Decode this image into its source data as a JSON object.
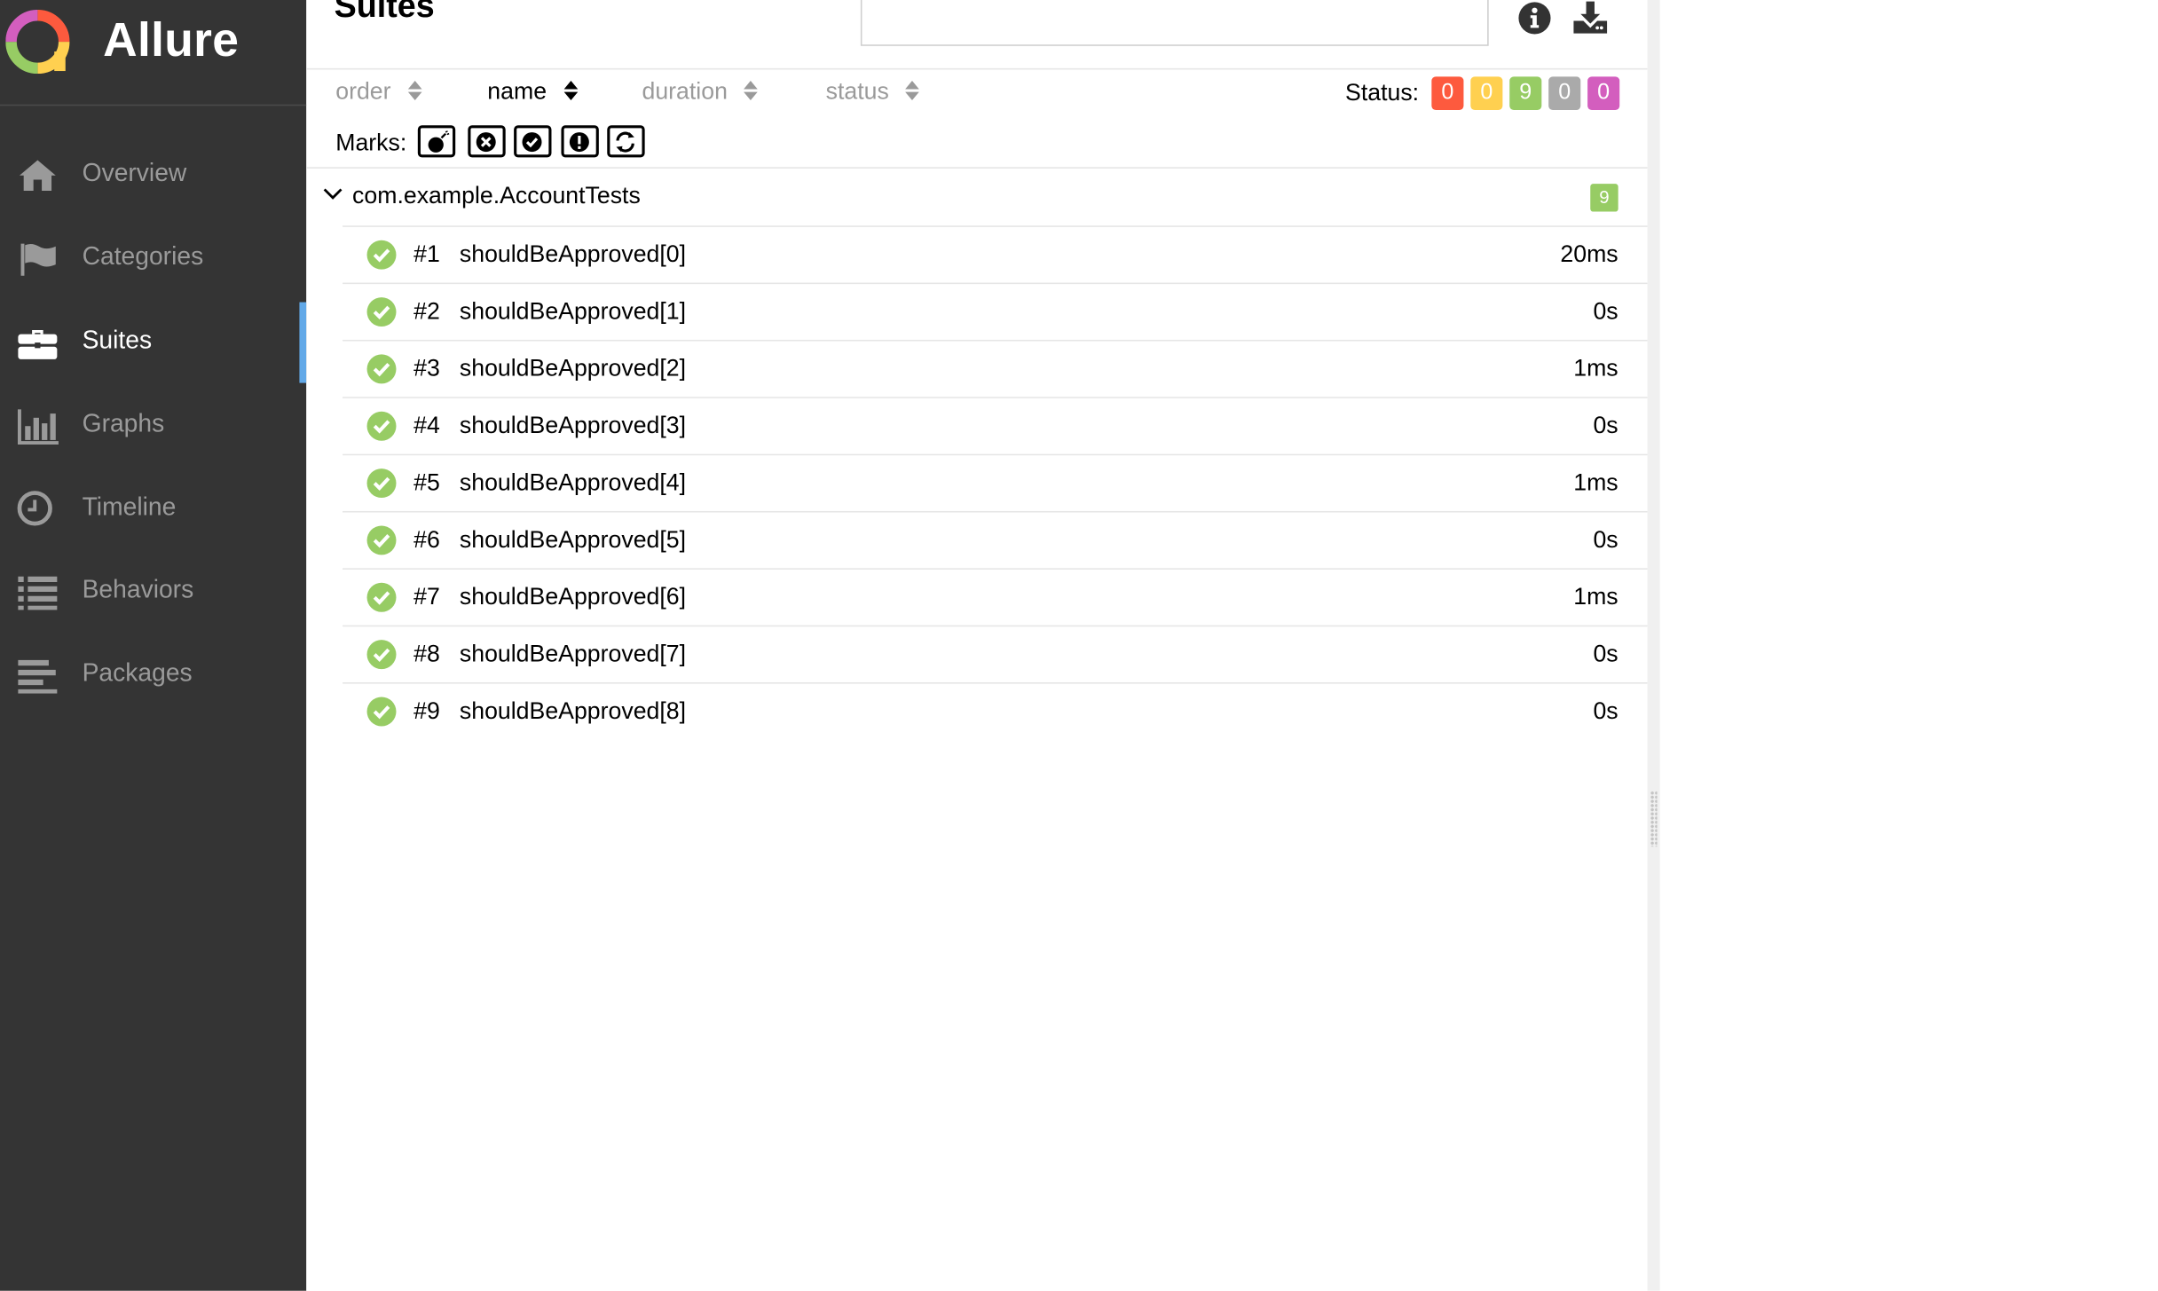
{
  "app": {
    "name": "Allure"
  },
  "sidebar": {
    "items": [
      {
        "label": "Overview",
        "icon": "home-icon",
        "active": false
      },
      {
        "label": "Categories",
        "icon": "flag-icon",
        "active": false
      },
      {
        "label": "Suites",
        "icon": "briefcase-icon",
        "active": true
      },
      {
        "label": "Graphs",
        "icon": "bar-chart-icon",
        "active": false
      },
      {
        "label": "Timeline",
        "icon": "clock-icon",
        "active": false
      },
      {
        "label": "Behaviors",
        "icon": "list-icon",
        "active": false
      },
      {
        "label": "Packages",
        "icon": "align-left-icon",
        "active": false
      }
    ]
  },
  "pane": {
    "title": "Suites",
    "search": {
      "value": "",
      "placeholder": ""
    },
    "tools": [
      "info-icon",
      "download-icon"
    ]
  },
  "sort": {
    "columns": [
      {
        "label": "order",
        "active": false
      },
      {
        "label": "name",
        "active": true
      },
      {
        "label": "duration",
        "active": false
      },
      {
        "label": "status",
        "active": false
      }
    ]
  },
  "status_filter": {
    "label": "Status:",
    "badges": [
      {
        "name": "failed",
        "count": "0",
        "color": "#fd5a3e"
      },
      {
        "name": "broken",
        "count": "0",
        "color": "#ffd050"
      },
      {
        "name": "passed",
        "count": "9",
        "color": "#97cc64"
      },
      {
        "name": "skipped",
        "count": "0",
        "color": "#aaaaaa"
      },
      {
        "name": "unknown",
        "count": "0",
        "color": "#d35ebe"
      }
    ]
  },
  "marks": {
    "label": "Marks:",
    "buttons": [
      "flaky-icon",
      "new-failed-icon",
      "new-passed-icon",
      "new-broken-icon",
      "retries-icon"
    ]
  },
  "group": {
    "name": "com.example.AccountTests",
    "count": "9"
  },
  "tests": [
    {
      "num": "#1",
      "name": "shouldBeApproved[0]",
      "duration": "20ms",
      "status": "passed"
    },
    {
      "num": "#2",
      "name": "shouldBeApproved[1]",
      "duration": "0s",
      "status": "passed"
    },
    {
      "num": "#3",
      "name": "shouldBeApproved[2]",
      "duration": "1ms",
      "status": "passed"
    },
    {
      "num": "#4",
      "name": "shouldBeApproved[3]",
      "duration": "0s",
      "status": "passed"
    },
    {
      "num": "#5",
      "name": "shouldBeApproved[4]",
      "duration": "1ms",
      "status": "passed"
    },
    {
      "num": "#6",
      "name": "shouldBeApproved[5]",
      "duration": "0s",
      "status": "passed"
    },
    {
      "num": "#7",
      "name": "shouldBeApproved[6]",
      "duration": "1ms",
      "status": "passed"
    },
    {
      "num": "#8",
      "name": "shouldBeApproved[7]",
      "duration": "0s",
      "status": "passed"
    },
    {
      "num": "#9",
      "name": "shouldBeApproved[8]",
      "duration": "0s",
      "status": "passed"
    }
  ],
  "colors": {
    "sidebar_bg": "#343434",
    "active_indicator": "#62a9e8",
    "passed": "#97cc64"
  }
}
